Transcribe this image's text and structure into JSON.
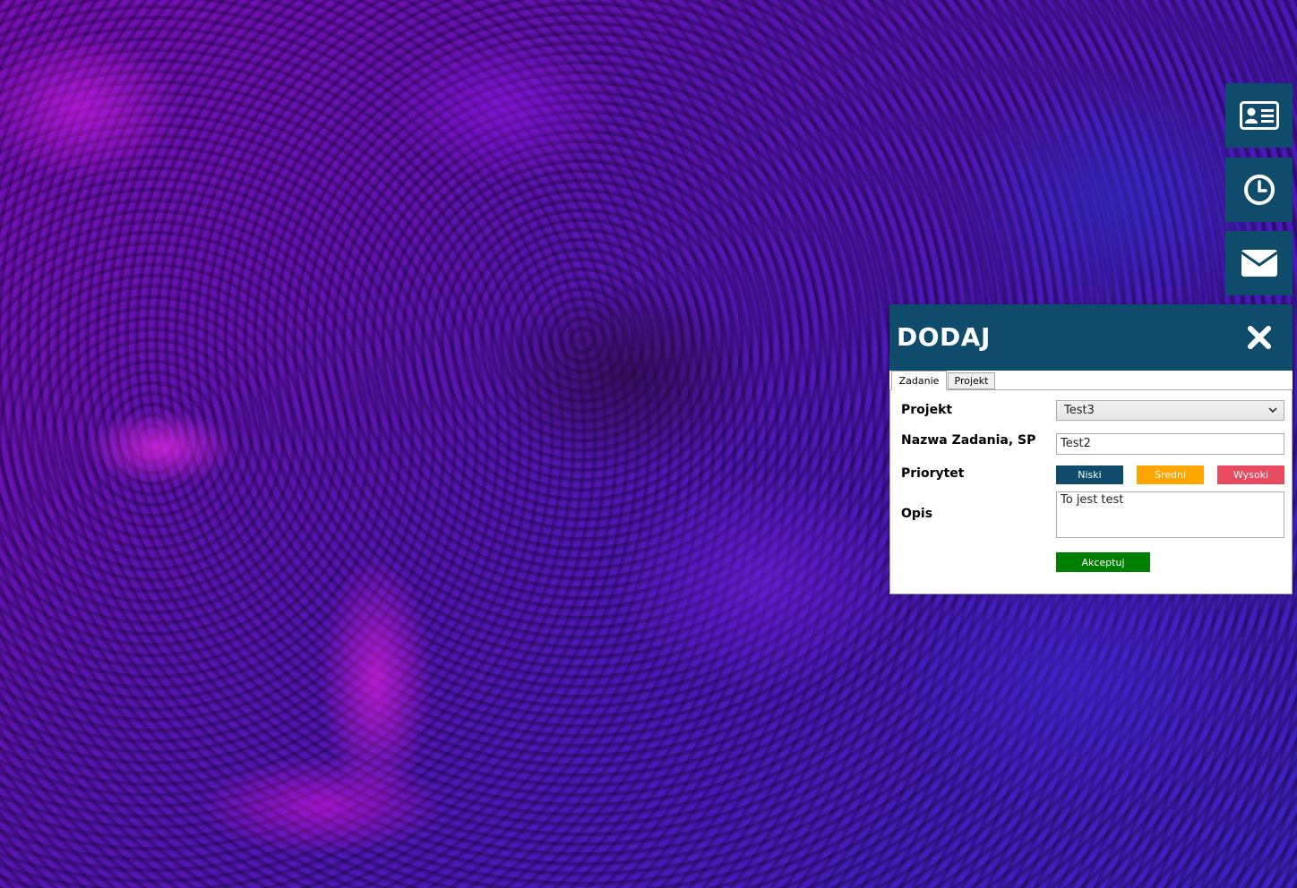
{
  "side_buttons": [
    {
      "icon": "id-card-icon"
    },
    {
      "icon": "clock-icon"
    },
    {
      "icon": "envelope-icon"
    }
  ],
  "dialog": {
    "title": "DODAJ",
    "close_icon": "close-icon",
    "tabs": [
      {
        "label": "Zadanie",
        "active": true
      },
      {
        "label": "Projekt",
        "active": false
      }
    ],
    "form": {
      "projekt_label": "Projekt",
      "projekt_value": "Test3",
      "nazwa_label": "Nazwa Zadania, SP",
      "nazwa_value": "Test2",
      "priorytet_label": "Priorytet",
      "priorities": [
        {
          "label": "Niski",
          "color": "#0f4b6b"
        },
        {
          "label": "Średni",
          "color": "#ffa500"
        },
        {
          "label": "Wysoki",
          "color": "#e84a5f"
        }
      ],
      "opis_label": "Opis",
      "opis_value": "To jest test",
      "accept_label": "Akceptuj",
      "accept_color": "#008000"
    }
  },
  "colors": {
    "accent": "#0f4b6b",
    "background_purple": "#7a0fb5",
    "background_blue": "#3b22c2"
  }
}
